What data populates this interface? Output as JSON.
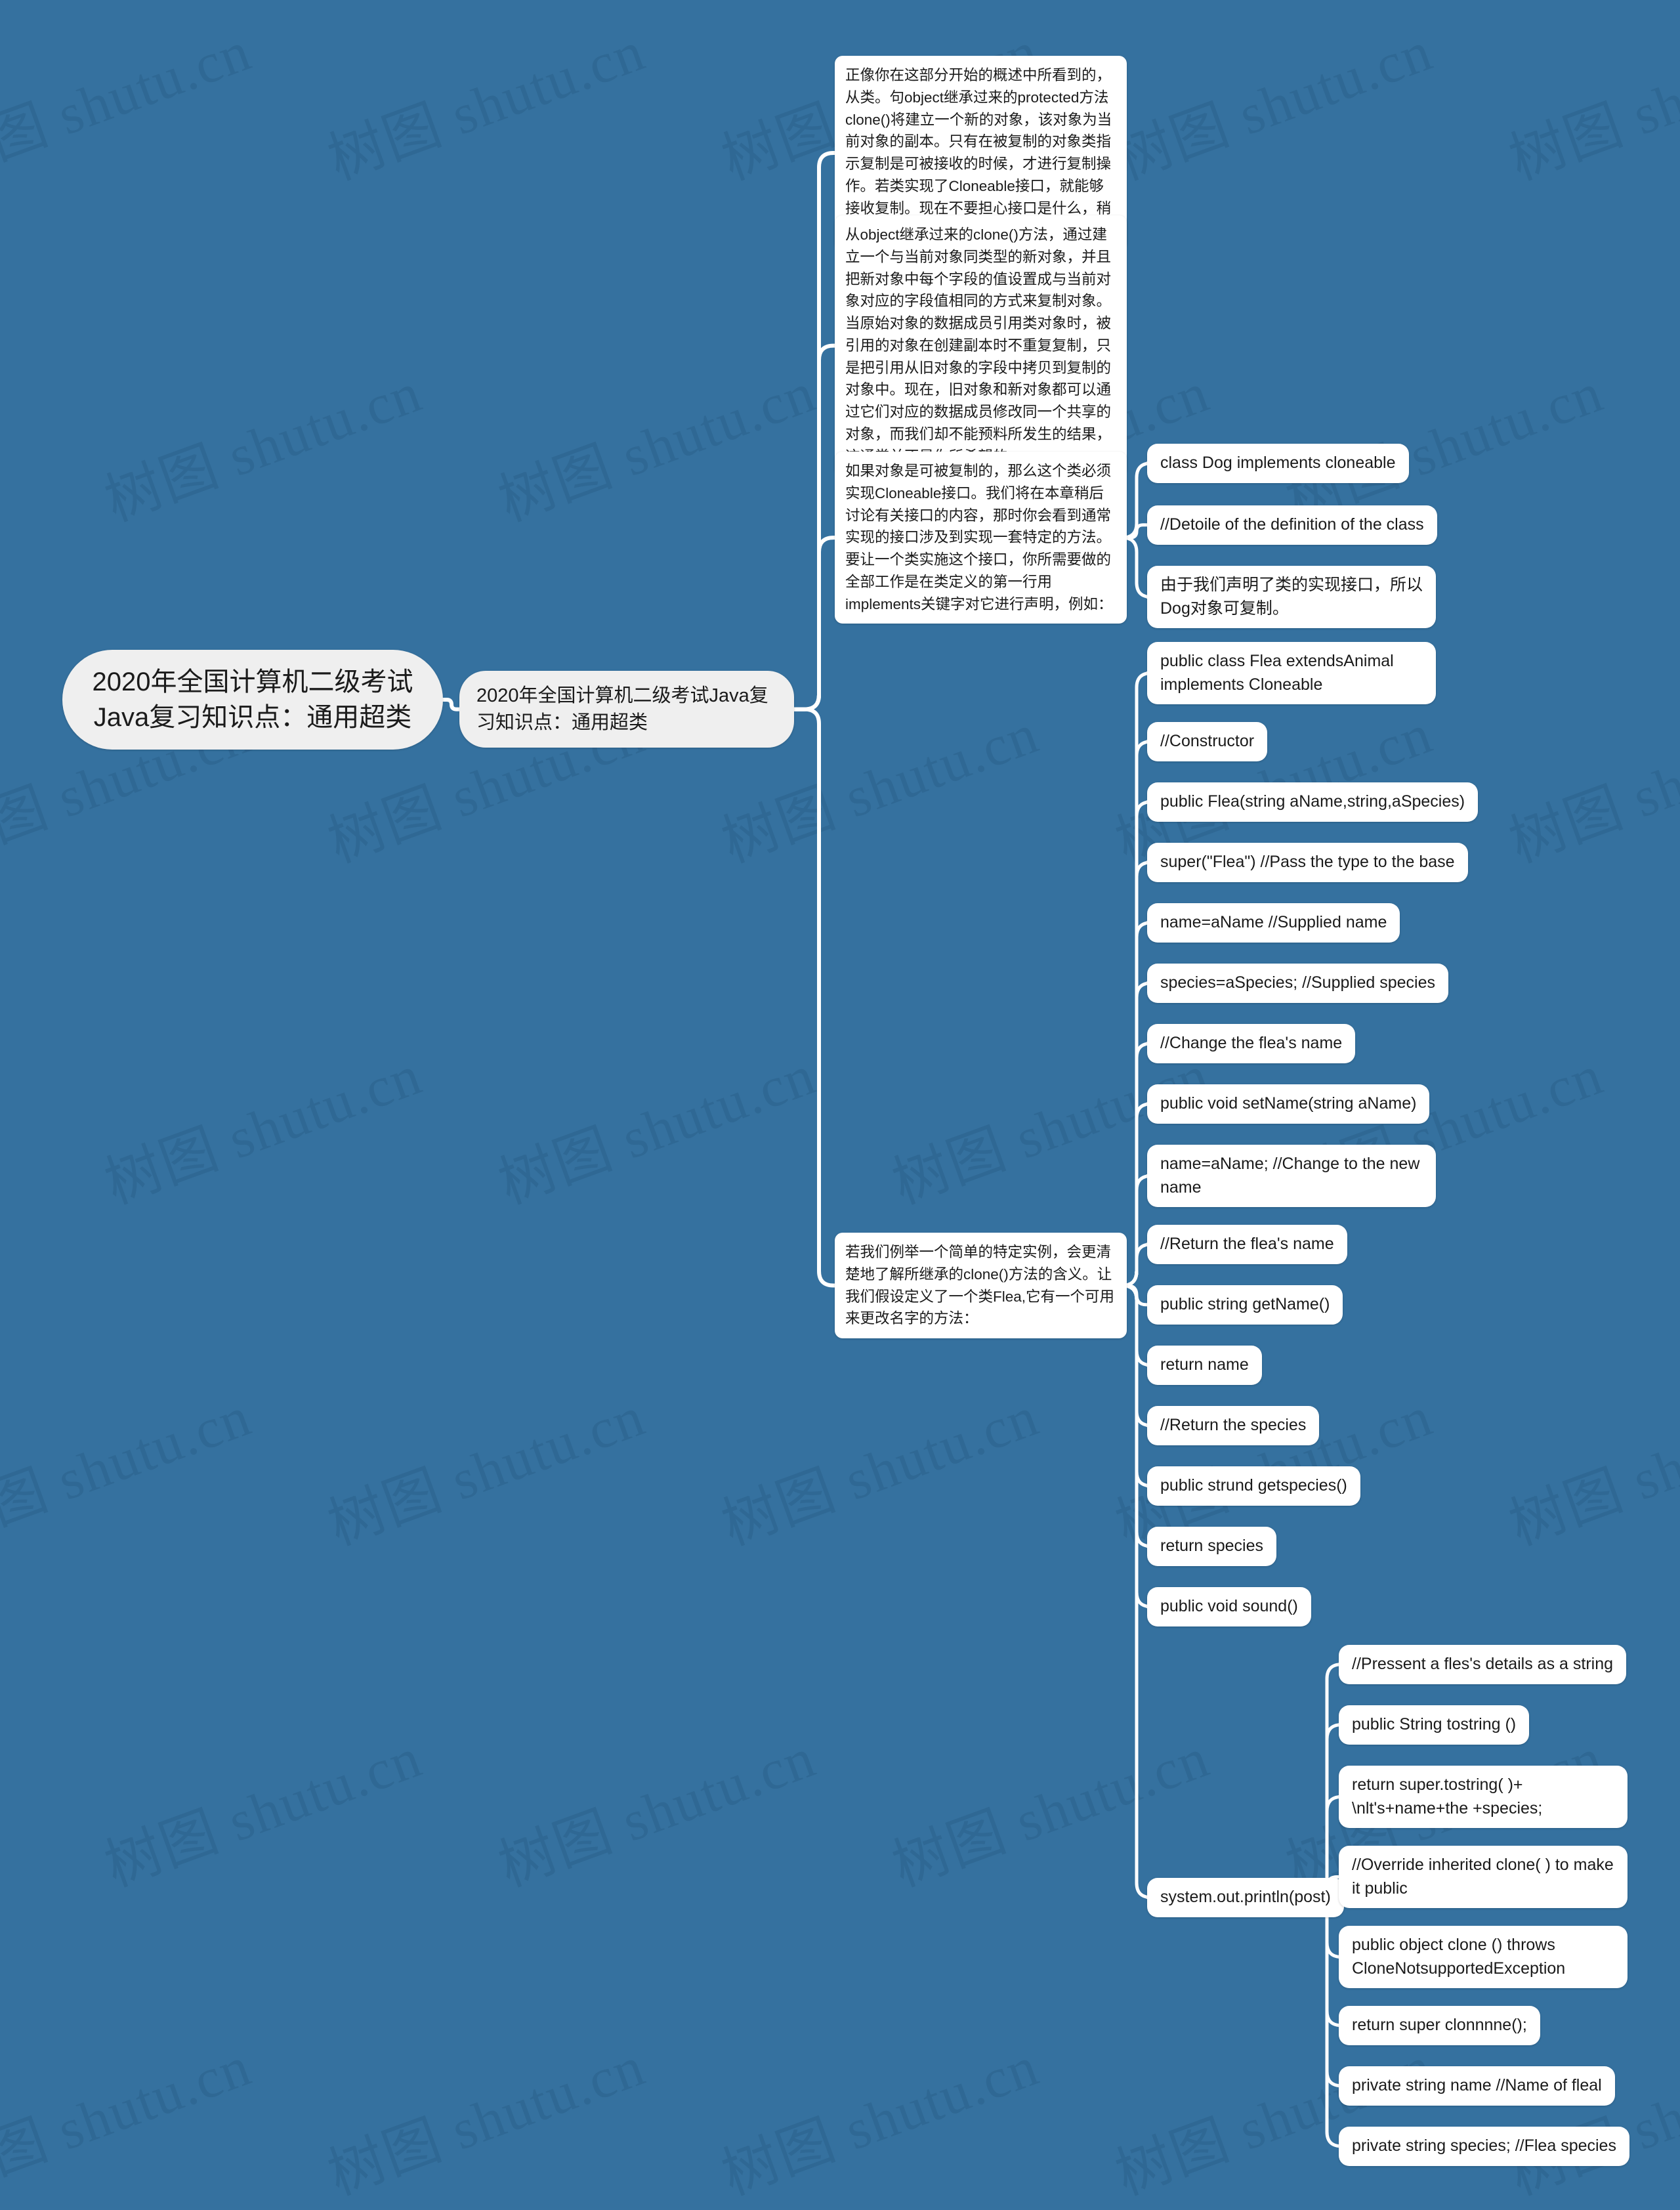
{
  "document": {
    "type": "mindmap",
    "background_color": "#35719F",
    "node_fill": "#FFFFFF",
    "root_fill": "#EFEFEF",
    "link_color": "#FFFFFF",
    "watermark_text": "树图 shutu.cn"
  },
  "root": {
    "label": "2020年全国计算机二级考试Java复习知识点：通用超类"
  },
  "level2": {
    "label": "2020年全国计算机二级考试Java复习知识点：通用超类"
  },
  "branches": [
    {
      "id": "p1",
      "label": "正像你在这部分开始的概述中所看到的，从类。句object继承过来的protected方法clone()将建立一个新的对象，该对象为当前对象的副本。只有在被复制的对象类指示复制是可被接收的时候，才进行复制操作。若类实现了Cloneable接口，就能够接收复制。现在不要担心接口是什么，稍后我们将介绍它。"
    },
    {
      "id": "p2",
      "label": "从object继承过来的clone()方法，通过建立一个与当前对象同类型的新对象，并且把新对象中每个字段的值设置成与当前对象对应的字段值相同的方式来复制对象。当原始对象的数据成员引用类对象时，被引用的对象在创建副本时不重复复制，只是把引用从旧对象的字段中拷贝到复制的对象中。现在，旧对象和新对象都可以通过它们对应的数据成员修改同一个共享的对象，而我们却不能预料所发生的结果，这通常并不是你所希望的。"
    },
    {
      "id": "p3",
      "label": "如果对象是可被复制的，那么这个类必须实现Cloneable接口。我们将在本章稍后讨论有关接口的内容，那时你会看到通常实现的接口涉及到实现一套特定的方法。要让一个类实施这个接口，你所需要做的全部工作是在类定义的第一行用implements关键字对它进行声明，例如："
    },
    {
      "id": "p4",
      "label": "若我们例举一个简单的特定实例，会更清楚地了解所继承的clone()方法的含义。让我们假设定义了一个类Flea,它有一个可用来更改名字的方法："
    }
  ],
  "p3_children": [
    {
      "id": "c1",
      "label": "class Dog implements cloneable"
    },
    {
      "id": "c2",
      "label": "//Detoile of the definition of the class"
    },
    {
      "id": "c3",
      "label": "由于我们声明了类的实现接口，所以Dog对象可复制。"
    }
  ],
  "p4_children": [
    {
      "id": "f1",
      "label": "public class Flea extendsAnimal implements Cloneable"
    },
    {
      "id": "f2",
      "label": "//Constructor"
    },
    {
      "id": "f3",
      "label": "public Flea(string aName,string,aSpecies)"
    },
    {
      "id": "f4",
      "label": "super(\"Flea\") //Pass the type to the base"
    },
    {
      "id": "f5",
      "label": "name=aName //Supplied name"
    },
    {
      "id": "f6",
      "label": "species=aSpecies; //Supplied species"
    },
    {
      "id": "f7",
      "label": "//Change the flea's name"
    },
    {
      "id": "f8",
      "label": "public void setName(string aName)"
    },
    {
      "id": "f9",
      "label": "name=aName; //Change to the new name"
    },
    {
      "id": "f10",
      "label": "//Return the flea's name"
    },
    {
      "id": "f11",
      "label": "public string getName()"
    },
    {
      "id": "f12",
      "label": "return name"
    },
    {
      "id": "f13",
      "label": "//Return the species"
    },
    {
      "id": "f14",
      "label": "public strund getspecies()"
    },
    {
      "id": "f15",
      "label": "return species"
    },
    {
      "id": "f16",
      "label": "public void sound()"
    },
    {
      "id": "f17",
      "label": "system.out.println(post)"
    }
  ],
  "println_children": [
    {
      "id": "g1",
      "label": "//Pressent a fles's details as a string"
    },
    {
      "id": "g2",
      "label": "public String tostring ()"
    },
    {
      "id": "g3",
      "label": "return super.tostring( )+ \\nlt's+name+the +species;"
    },
    {
      "id": "g4",
      "label": "//Override inherited clone( ) to make it public"
    },
    {
      "id": "g5",
      "label": "public object clone () throws CloneNotsupportedException"
    },
    {
      "id": "g6",
      "label": "return super clonnnne();"
    },
    {
      "id": "g7",
      "label": "private string name //Name of fleal"
    },
    {
      "id": "g8",
      "label": "private string species; //Flea species"
    }
  ]
}
